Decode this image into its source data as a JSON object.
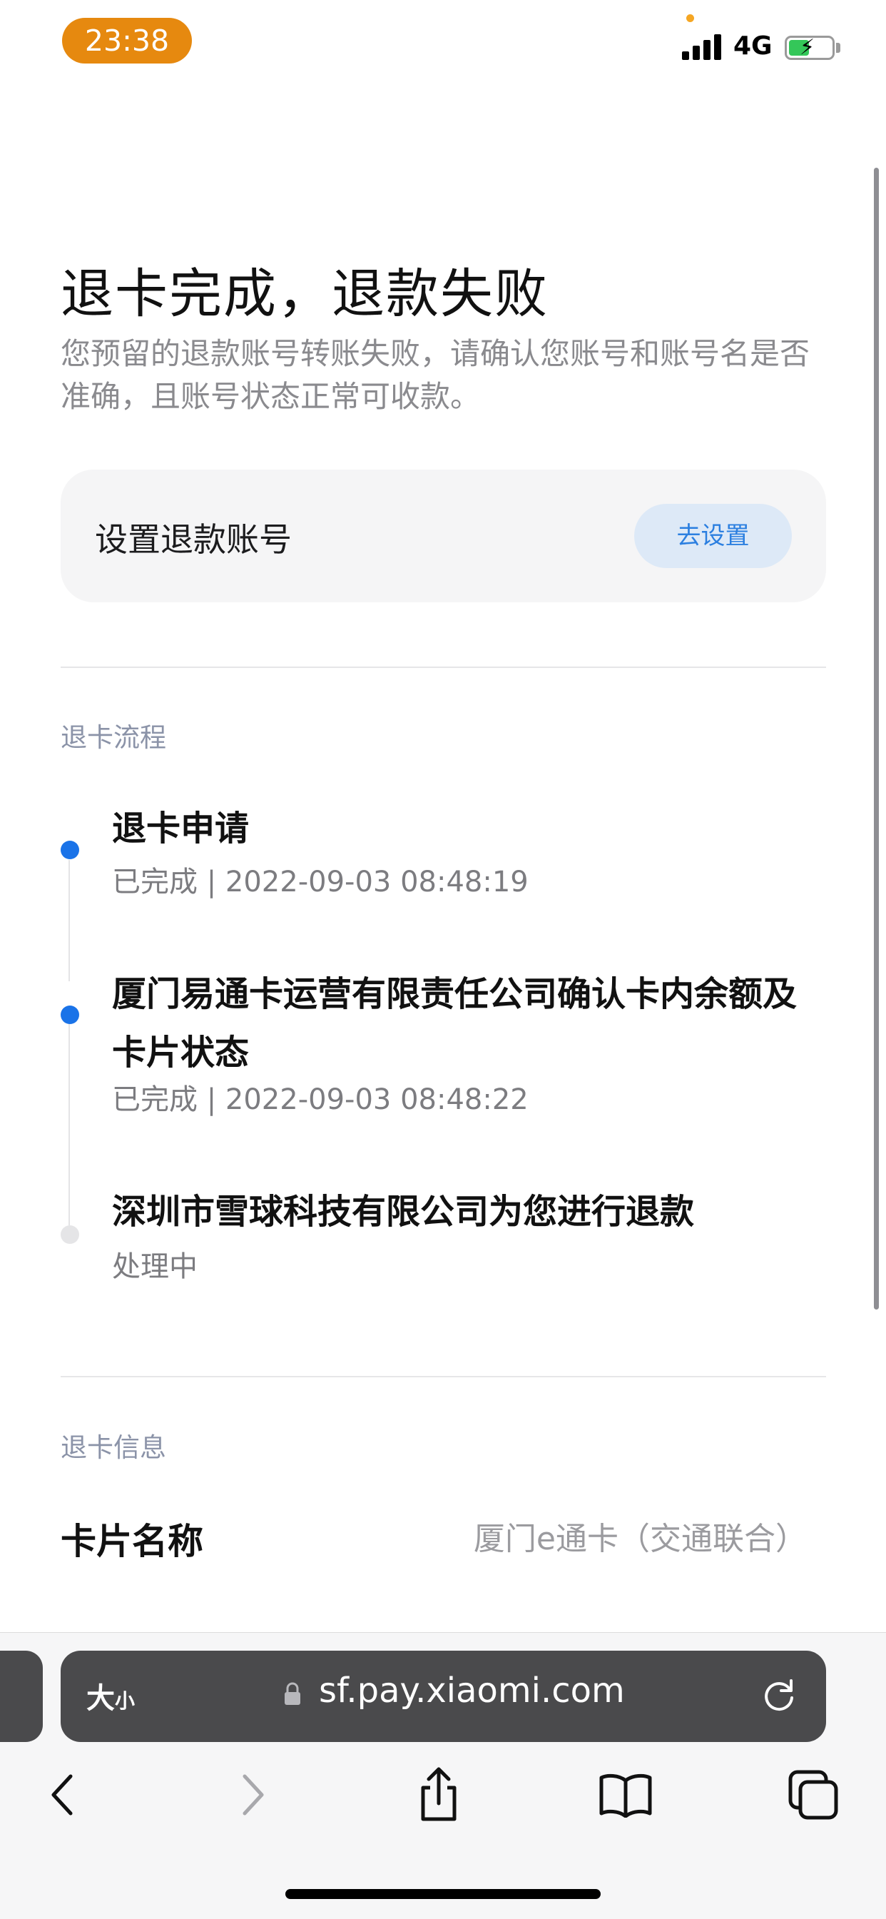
{
  "status_bar": {
    "time": "23:38",
    "network": "4G"
  },
  "header": {
    "title": "退卡完成，退款失败",
    "description": "您预留的退款账号转账失败，请确认您账号和账号名是否准确，且账号状态正常可收款。"
  },
  "account_card": {
    "label": "设置退款账号",
    "button": "去设置"
  },
  "process": {
    "section_title": "退卡流程",
    "steps": [
      {
        "title": "退卡申请",
        "status": "已完成 | 2022-09-03 08:48:19",
        "state": "done"
      },
      {
        "title": "厦门易通卡运营有限责任公司确认卡内余额及卡片状态",
        "status": "已完成 | 2022-09-03 08:48:22",
        "state": "done"
      },
      {
        "title": "深圳市雪球科技有限公司为您进行退款",
        "status": "处理中",
        "state": "pending"
      }
    ]
  },
  "info": {
    "section_title": "退卡信息",
    "card_name_label": "卡片名称",
    "card_name_value": "厦门e通卡（交通联合）"
  },
  "browser": {
    "text_size_big": "大",
    "text_size_small": "小",
    "url": "sf.pay.xiaomi.com"
  },
  "colors": {
    "accent": "#1a73e8",
    "done_dot": "#1a73e8",
    "pending_dot": "#e5e5e7",
    "time_pill": "#e6890f"
  }
}
